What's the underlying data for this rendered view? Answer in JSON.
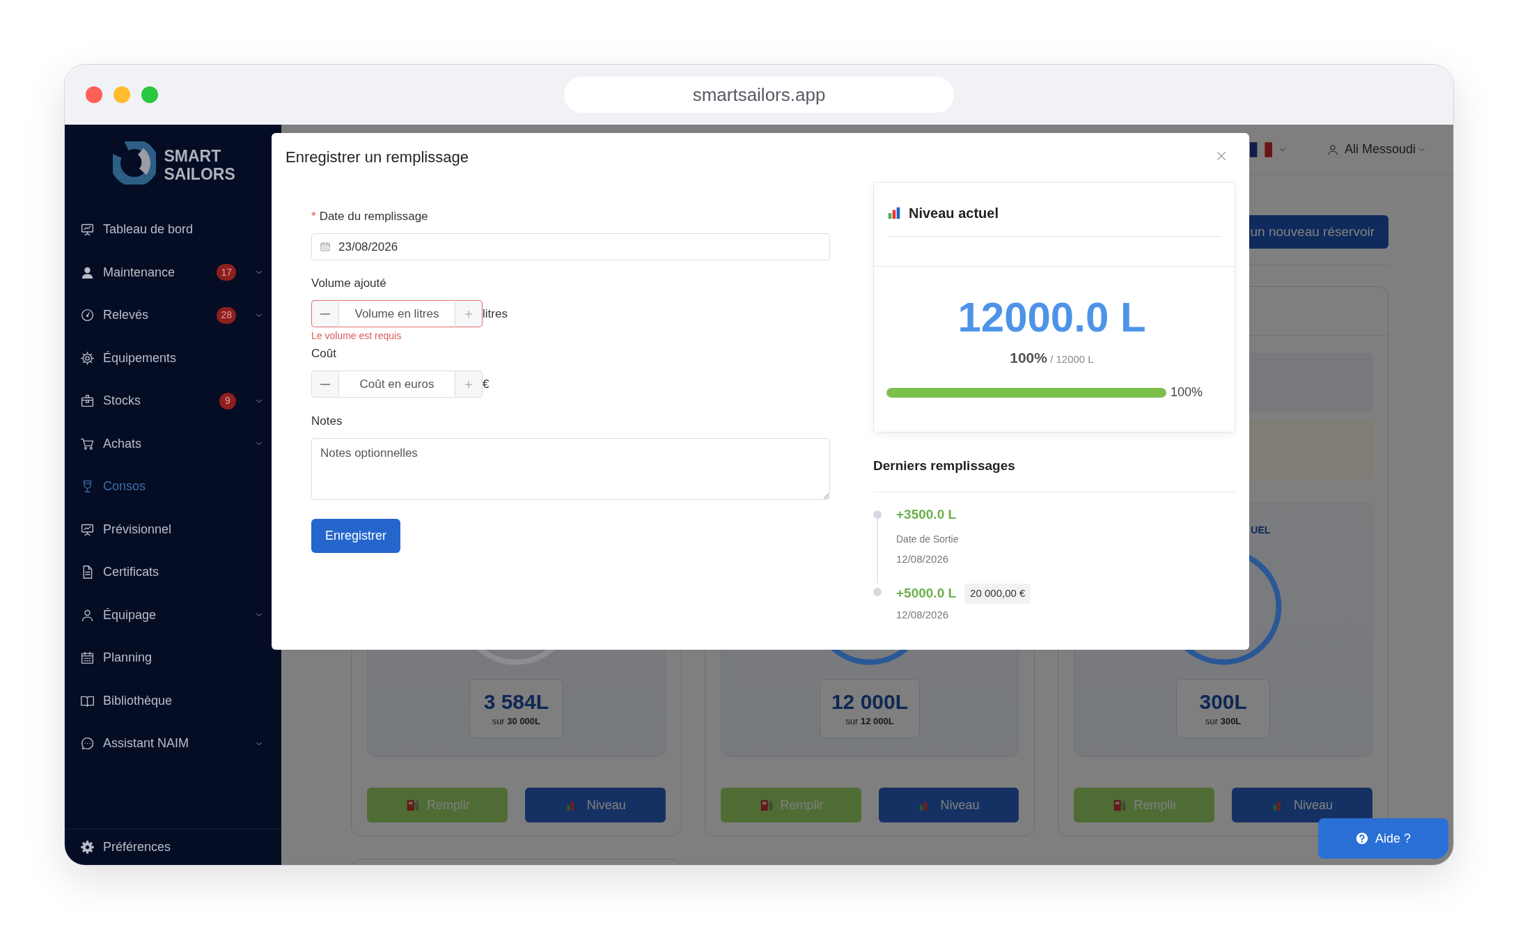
{
  "browser": {
    "address": "smartsailors.app"
  },
  "sidebar": {
    "brand": "SMART SAILORS",
    "items": [
      {
        "label": "Tableau de bord",
        "submenu": false,
        "selected": false
      },
      {
        "label": "Maintenance",
        "badge": "17",
        "submenu": true,
        "selected": false
      },
      {
        "label": "Relevés",
        "badge": "28",
        "submenu": true,
        "selected": false
      },
      {
        "label": "Équipements",
        "submenu": false,
        "selected": false
      },
      {
        "label": "Stocks",
        "badge": "9",
        "submenu": true,
        "selected": false
      },
      {
        "label": "Achats",
        "submenu": true,
        "selected": false
      },
      {
        "label": "Consos",
        "submenu": false,
        "selected": true
      },
      {
        "label": "Prévisionnel",
        "submenu": false,
        "selected": false
      },
      {
        "label": "Certificats",
        "submenu": false,
        "selected": false
      },
      {
        "label": "Équipage",
        "submenu": true,
        "selected": false
      },
      {
        "label": "Planning",
        "submenu": false,
        "selected": false
      },
      {
        "label": "Bibliothèque",
        "submenu": false,
        "selected": false
      },
      {
        "label": "Assistant NAIM",
        "submenu": true,
        "selected": false
      }
    ],
    "footer": "Préférences"
  },
  "header": {
    "user": "Ali Messoudi"
  },
  "toolbar": {
    "new_tank_button": "un nouveau réservoir"
  },
  "tanks": [
    {
      "color": "#8c8e92",
      "volume": "3 584L",
      "capacity": "sur **30 000L**",
      "fill_button": "Remplir",
      "level_button": "Niveau"
    },
    {
      "color": "#2a5896",
      "volume": "12 000L",
      "capacity": "sur **12 000L**",
      "fill_button": "Remplir",
      "level_button": "Niveau"
    },
    {
      "title": "UEL",
      "color": "#2a5896",
      "volume": "300L",
      "capacity": "sur **300L**",
      "fill_button": "Remplir",
      "level_button": "Niveau"
    }
  ],
  "help_button": "Aide ?",
  "modal": {
    "title": "Enregistrer un remplissage",
    "form": {
      "date": {
        "required_mark": "*",
        "label": "Date du remplissage",
        "value": "23/08/2026"
      },
      "volume": {
        "label": "Volume ajouté",
        "placeholder": "Volume en litres",
        "unit": "litres",
        "invalid": true,
        "error": "Le volume est requis"
      },
      "cost": {
        "label": "Coût",
        "placeholder": "Coût en euros",
        "unit": "€",
        "invalid": false
      },
      "notes": {
        "label": "Notes",
        "placeholder": "Notes optionnelles"
      },
      "submit": "Enregistrer"
    },
    "level_card": {
      "title": "Niveau actuel",
      "current": "12000.0 L",
      "percent": "100%",
      "capacity": "/ 12000 L",
      "level": 1,
      "reading": "100%"
    },
    "history": {
      "title": "Derniers remplissages",
      "entries": [
        {
          "amount": "+3500.0 L",
          "note": "Date de Sortie",
          "date": "12/08/2026"
        },
        {
          "amount": "+5000.0 L",
          "cost": "20 000,00 €",
          "date": "12/08/2026"
        }
      ]
    }
  }
}
